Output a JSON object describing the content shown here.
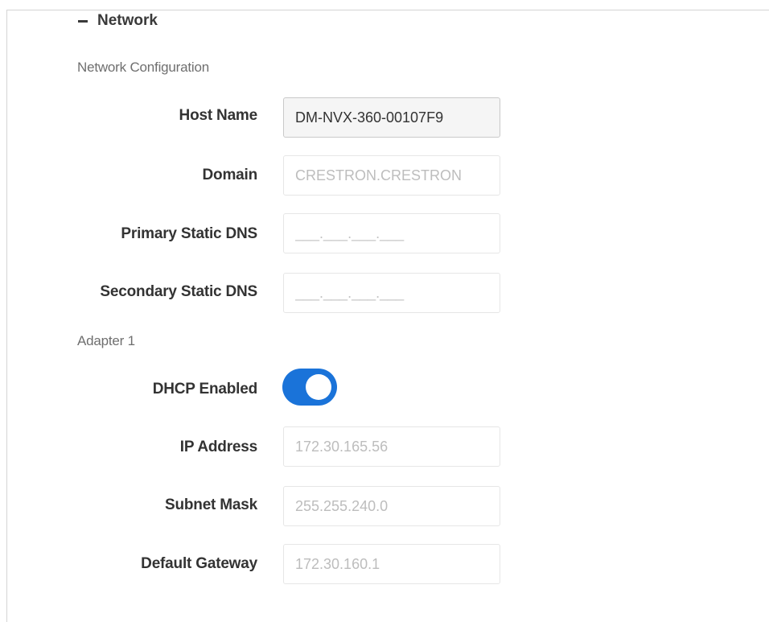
{
  "section": {
    "title": "Network",
    "collapse_icon": "minus-icon"
  },
  "network_configuration": {
    "heading": "Network Configuration",
    "host_name": {
      "label": "Host Name",
      "value": "DM-NVX-360-00107F9"
    },
    "domain": {
      "label": "Domain",
      "value": "CRESTRON.CRESTRON"
    },
    "primary_dns": {
      "label": "Primary Static DNS",
      "placeholder": "___.___.___.___"
    },
    "secondary_dns": {
      "label": "Secondary Static DNS",
      "placeholder": "___.___.___.___"
    }
  },
  "adapter": {
    "heading": "Adapter 1",
    "dhcp": {
      "label": "DHCP Enabled",
      "enabled": true,
      "color": "#1a73d9"
    },
    "ip_address": {
      "label": "IP Address",
      "value": "172.30.165.56"
    },
    "subnet_mask": {
      "label": "Subnet Mask",
      "value": "255.255.240.0"
    },
    "default_gateway": {
      "label": "Default Gateway",
      "value": "172.30.160.1"
    }
  }
}
